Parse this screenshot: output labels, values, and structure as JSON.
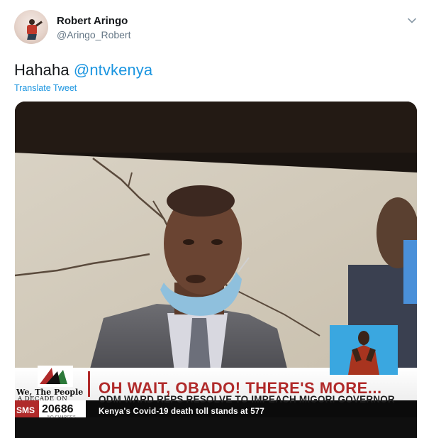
{
  "author": {
    "name": "Robert Aringo",
    "handle": "@Aringo_Robert"
  },
  "tweet": {
    "text_prefix": "Hahaha ",
    "mention": "@ntvkenya",
    "translate_label": "Translate Tweet"
  },
  "icons": {
    "caret": "chevron-down-icon"
  },
  "media": {
    "tv_headline": "OH WAIT, OBADO! THERE'S MORE...",
    "tv_subheadline": "ODM WARD REPS RESOLVE TO IMPEACH MIGORI GOVERNOR",
    "brand_line1": "We, The People",
    "brand_line2": "A DECADE ON",
    "sms_label": "SMS",
    "sms_number": "20686",
    "sms_sub": "NO CHARGES",
    "news_ticker": "Kenya's Covid-19 death toll stands at 577"
  },
  "colors": {
    "link": "#1b95e0",
    "secondary_text": "#657786",
    "headline_red": "#b02a2a"
  }
}
